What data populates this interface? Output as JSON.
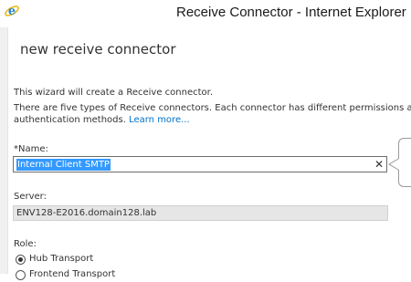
{
  "window": {
    "title": "Receive Connector - Internet Explorer",
    "app_icon": "internet-explorer-icon"
  },
  "wizard": {
    "title": "new receive connector",
    "intro_line1": "This wizard will create a Receive connector.",
    "intro_line2": "There are five types of Receive connectors. Each connector has different permissions and",
    "intro_line3": "authentication methods. ",
    "learn_more": "Learn more..."
  },
  "name_field": {
    "label": "*Name:",
    "value": "Internal Client SMTP",
    "clear_icon": "close-icon"
  },
  "server_field": {
    "label": "Server:",
    "value": "ENV128-E2016.domain128.lab"
  },
  "role": {
    "label": "Role:",
    "options": [
      {
        "label": "Hub Transport",
        "selected": true
      },
      {
        "label": "Frontend Transport",
        "selected": false
      }
    ]
  },
  "colors": {
    "accent": "#0072c6",
    "selection": "#3399ff"
  }
}
